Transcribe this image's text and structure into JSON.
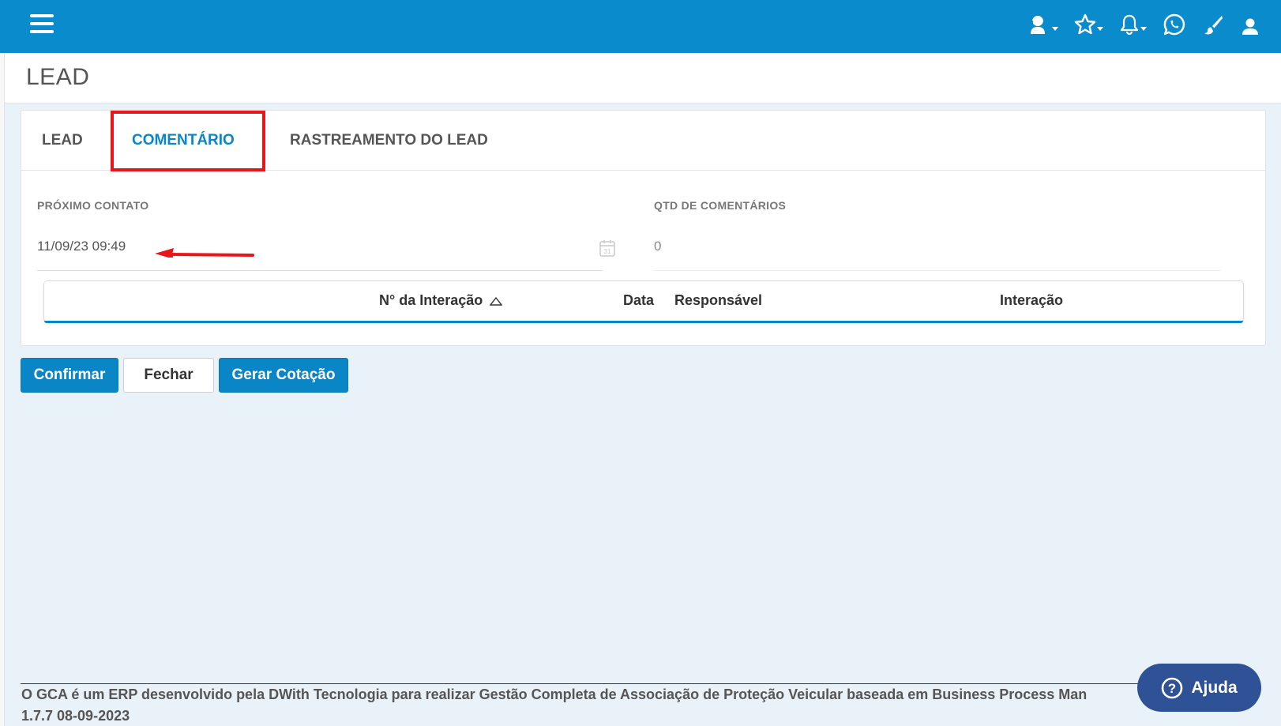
{
  "header": {
    "menu_icon": "hamburger-icon",
    "icons": [
      "support-agent-icon",
      "star-icon",
      "bell-icon",
      "whatsapp-icon",
      "paintbrush-icon",
      "user-icon"
    ],
    "brand_color": "#0a8bcc"
  },
  "page": {
    "title": "LEAD"
  },
  "tabs": [
    {
      "label": "LEAD",
      "active": false
    },
    {
      "label": "COMENTÁRIO",
      "active": true
    },
    {
      "label": "RASTREAMENTO DO LEAD",
      "active": false
    }
  ],
  "form": {
    "next_contact_label": "PRÓXIMO CONTATO",
    "next_contact_value": "11/09/23 09:49",
    "comment_count_label": "QTD DE COMENTÁRIOS",
    "comment_count_value": "0"
  },
  "grid": {
    "columns": [
      "N° da Interação",
      "Data",
      "Responsável",
      "Interação"
    ],
    "sort_column": "N° da Interação",
    "rows": []
  },
  "buttons": {
    "confirm": "Confirmar",
    "close": "Fechar",
    "quote": "Gerar Cotação"
  },
  "footer": {
    "text": "O GCA é um ERP desenvolvido pela DWith Tecnologia para realizar Gestão Completa de Associação de Proteção Veicular baseada em Business Process Man",
    "version": "1.7.7 08-09-2023"
  },
  "help": {
    "label": "Ajuda"
  },
  "annotation_colors": {
    "highlight": "#e8161b"
  }
}
